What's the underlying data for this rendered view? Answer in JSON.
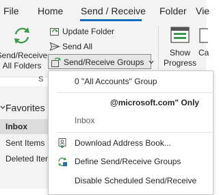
{
  "tabs": [
    {
      "label": "File",
      "active": false
    },
    {
      "label": "Home",
      "active": false
    },
    {
      "label": "Send / Receive",
      "active": true
    },
    {
      "label": "Folder",
      "active": false
    },
    {
      "label": "Vie",
      "active": false
    }
  ],
  "ribbon": {
    "send_receive_all": {
      "line1": "Send/Receive",
      "line2": "All Folders"
    },
    "update_folder": "Update Folder",
    "send_all": "Send All",
    "send_receive_groups": "Send/Receive Groups",
    "show_progress": {
      "line1": "Show",
      "line2": "Progress"
    },
    "cancel_partial": "Ca",
    "group_label": "S"
  },
  "left_pane": {
    "favorites": "Favorites",
    "items": [
      {
        "label": "Inbox",
        "selected": true
      },
      {
        "label": "Sent Items",
        "selected": false
      },
      {
        "label": "Deleted Item",
        "selected": false
      }
    ]
  },
  "menu": {
    "all_accounts_group": "0 \"All Accounts\" Group",
    "account_only": "@microsoft.com\" Only",
    "inbox": "Inbox",
    "download_address_book": "Download Address Book...",
    "define_groups": "Define Send/Receive Groups",
    "disable_scheduled": "Disable Scheduled Send/Receive"
  },
  "colors": {
    "accent": "#0f6cbd",
    "icon_green": "#3a9a4a",
    "icon_blue": "#2e6db4"
  }
}
